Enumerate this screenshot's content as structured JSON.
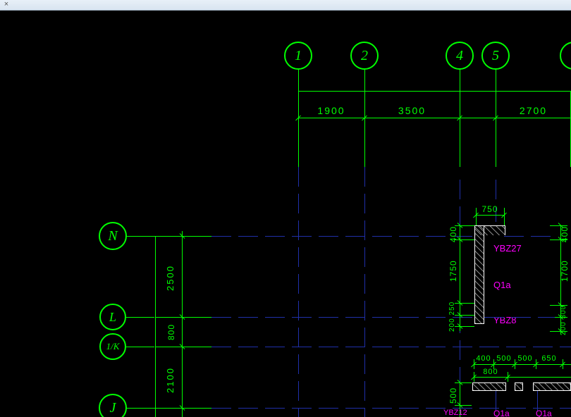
{
  "titlebar": {
    "close": "×"
  },
  "grid": {
    "top": {
      "1": "1",
      "2": "2",
      "4": "4",
      "5": "5"
    },
    "left": {
      "N": "N",
      "L": "L",
      "oneK": "1/K",
      "J": "J"
    }
  },
  "dims": {
    "top": {
      "d1": "1900",
      "d2": "3500",
      "d3": "2700"
    },
    "left": {
      "d1": "2500",
      "d2": "800",
      "d3": "2100"
    },
    "right_outer": {
      "d1": "400",
      "d2": "1700",
      "d3": "200 300"
    },
    "right_inner": {
      "d1": "400",
      "d2": "1750",
      "d3": "200 250"
    },
    "detail_top": {
      "d1": "750"
    },
    "detail_bot1": {
      "a": "400",
      "b": "500",
      "c": "500",
      "d": "650"
    },
    "detail_bot2": {
      "a": "800"
    },
    "detail_bot_right": {
      "d1": "500"
    }
  },
  "labels": {
    "ybz27": "YBZ27",
    "q1a": "Q1a",
    "ybz8": "YBZ8",
    "ybz12": "YBZ12",
    "q1a_2": "Q1a",
    "q1a_3": "Q1a"
  }
}
